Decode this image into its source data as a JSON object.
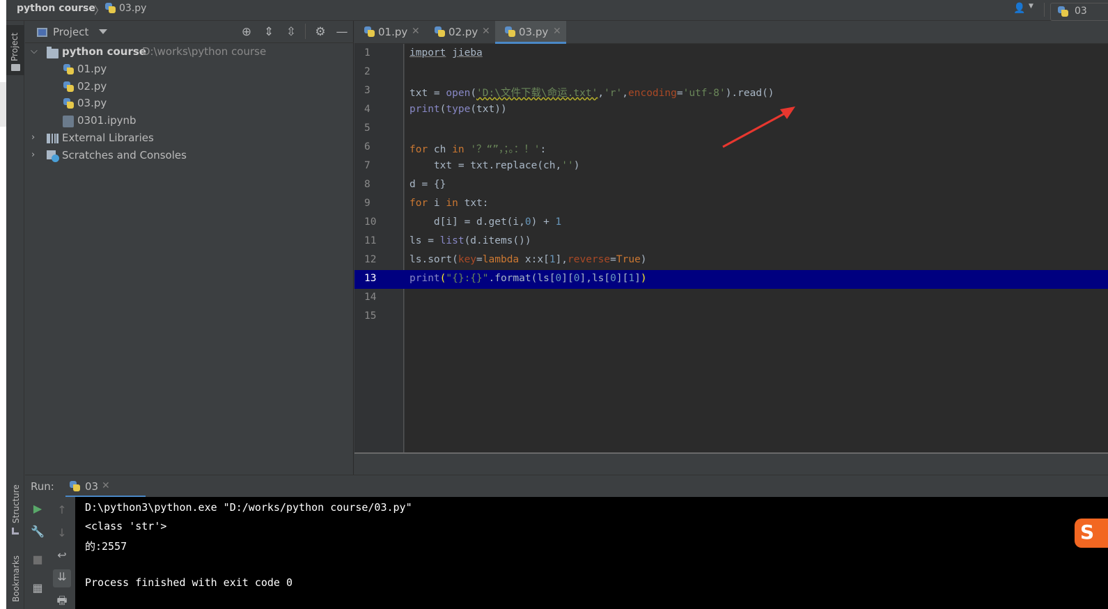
{
  "titlebar": {
    "project": "python course",
    "separator": "〉",
    "file": "03.py",
    "run_config": "03"
  },
  "tool_strip": {
    "project_tab": "Project",
    "structure_tab": "Structure",
    "bookmarks_tab": "Bookmarks"
  },
  "project_panel": {
    "title": "Project",
    "tree": {
      "root_label": "python course",
      "root_path": "D:\\works\\python course",
      "files": [
        "01.py",
        "02.py",
        "03.py",
        "0301.ipynb"
      ],
      "external_libraries": "External Libraries",
      "scratches": "Scratches and Consoles"
    }
  },
  "editor": {
    "tabs": [
      {
        "label": "01.py"
      },
      {
        "label": "02.py"
      },
      {
        "label": "03.py"
      }
    ],
    "active_tab": "03.py",
    "line_numbers": [
      "1",
      "2",
      "3",
      "4",
      "5",
      "6",
      "7",
      "8",
      "9",
      "10",
      "11",
      "12",
      "13",
      "14",
      "15"
    ],
    "highlighted_line": "13",
    "code": {
      "l1_kw": "import",
      "l1_mod": "jieba",
      "l3_a": "txt = ",
      "l3_open": "open",
      "l3_path": "'D:\\文件下载\\命运.txt'",
      "l3_mode": "'r'",
      "l3_param": "encoding",
      "l3_enc": "'utf-8'",
      "l3_tail": ").read()",
      "l4_print": "print",
      "l4_type": "type",
      "l4_rest": "(txt))",
      "l6_for": "for",
      "l6_ch": " ch ",
      "l6_in": "in",
      "l6_str": "'？“”，；。：！'",
      "l7": "    txt = txt.replace(ch",
      "l7_str": "''",
      "l8": "d = {}",
      "l9_for": "for",
      "l9_i": " i ",
      "l9_in": "in",
      "l9_rest": " txt:",
      "l10_a": "    d[i] = d.get(i",
      "l10_zero": "0",
      "l10_b": ") + ",
      "l10_one": "1",
      "l11_a": "ls = ",
      "l11_list": "list",
      "l11_b": "(d.items())",
      "l12_a": "ls.sort(",
      "l12_key": "key",
      "l12_lambda": "lambda",
      "l12_b": " x:x[",
      "l12_one": "1",
      "l12_c": "]",
      "l12_rev": "reverse",
      "l12_true": "True",
      "l13_print": "print",
      "l13_str": "\"{}:{}\"",
      "l13_a": ".format(ls[",
      "l13_z1": "0",
      "l13_b": "][",
      "l13_z2": "0",
      "l13_c": "]",
      "l13_d": "ls[",
      "l13_z3": "0",
      "l13_e": "][",
      "l13_one": "1",
      "l13_f": "])"
    }
  },
  "run_panel": {
    "label": "Run:",
    "tab_label": "03",
    "console_lines": [
      "D:\\python3\\python.exe \"D:/works/python course/03.py\"",
      "<class 'str'>",
      "的:2557",
      "",
      "Process finished with exit code 0"
    ]
  },
  "colors": {
    "keyword": "#cc7832",
    "string": "#6a8759",
    "number": "#6897bb",
    "builtin": "#8888c6",
    "highlight_line": "#000080",
    "annotation_arrow": "#e8372f"
  },
  "ime_badge": "S"
}
